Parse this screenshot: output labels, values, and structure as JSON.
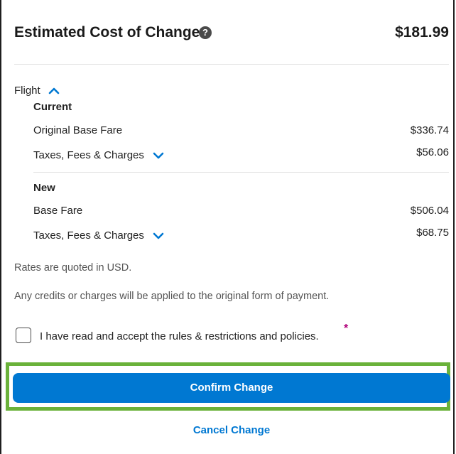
{
  "header": {
    "title": "Estimated Cost of Change",
    "total": "$181.99"
  },
  "flight": {
    "label": "Flight",
    "current": {
      "heading": "Current",
      "base_label": "Original Base Fare",
      "base_value": "$336.74",
      "taxes_label": "Taxes, Fees & Charges",
      "taxes_value": "$56.06"
    },
    "new": {
      "heading": "New",
      "base_label": "Base Fare",
      "base_value": "$506.04",
      "taxes_label": "Taxes, Fees & Charges",
      "taxes_value": "$68.75"
    }
  },
  "notes": {
    "currency": "Rates are quoted in USD.",
    "payment": "Any credits or charges will be applied to the original form of payment."
  },
  "agreement": {
    "label": "I have read and accept the rules & restrictions and policies.",
    "required_mark": "*"
  },
  "actions": {
    "confirm_label": "Confirm Change",
    "cancel_label": "Cancel Change"
  },
  "colors": {
    "accent": "#0078d2",
    "highlight": "#6ab23a",
    "required": "#b0007a"
  },
  "icons": {
    "help": "question-circle-icon",
    "expand_up": "chevron-up-icon",
    "expand_down": "chevron-down-icon"
  }
}
